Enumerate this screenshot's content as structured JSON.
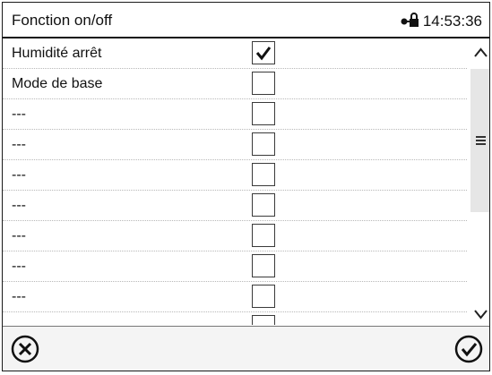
{
  "header": {
    "title": "Fonction on/off",
    "time": "14:53:36",
    "lock_icon": "lock-key-icon"
  },
  "rows": [
    {
      "label": "Humidité arrêt",
      "checked": true
    },
    {
      "label": "Mode de base",
      "checked": false
    },
    {
      "label": "---",
      "checked": false
    },
    {
      "label": "---",
      "checked": false
    },
    {
      "label": "---",
      "checked": false
    },
    {
      "label": "---",
      "checked": false
    },
    {
      "label": "---",
      "checked": false
    },
    {
      "label": "---",
      "checked": false
    },
    {
      "label": "---",
      "checked": false
    },
    {
      "label": "",
      "checked": false
    }
  ],
  "scrollbar": {
    "up_icon": "chevron-up-icon",
    "thumb_icon": "drag-handle-icon",
    "down_icon": "chevron-down-icon"
  },
  "footer": {
    "cancel_icon": "cancel-circle-icon",
    "confirm_icon": "confirm-check-circle-icon"
  }
}
